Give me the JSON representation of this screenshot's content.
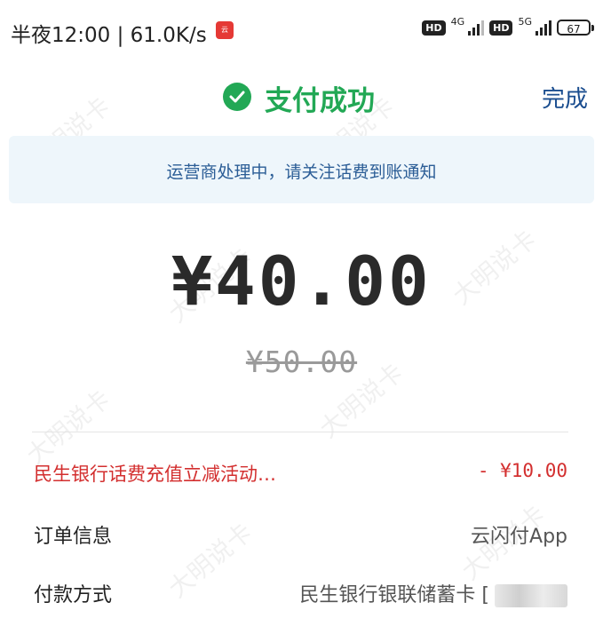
{
  "status_bar": {
    "time": "半夜12:00 | 61.0K/s",
    "sim1_badge": "HD",
    "sim1_network": "4G",
    "sim2_badge": "HD",
    "sim2_network": "5G",
    "battery": "67"
  },
  "header": {
    "title": "支付成功",
    "done_label": "完成"
  },
  "notice": {
    "text": "运营商处理中，请关注话费到账通知"
  },
  "payment": {
    "amount": "¥40.00",
    "original_amount": "¥50.00"
  },
  "details": [
    {
      "label": "民生银行话费充值立减活动…",
      "value": "- ¥10.00"
    },
    {
      "label": "订单信息",
      "value": "云闪付App"
    },
    {
      "label": "付款方式",
      "value": "民生银行银联储蓄卡 ["
    }
  ],
  "watermark": "大明说卡",
  "colors": {
    "success_green": "#22a855",
    "link_blue": "#1a4d8f",
    "notice_bg": "#eef6fb",
    "promo_red": "#d32f2f"
  }
}
